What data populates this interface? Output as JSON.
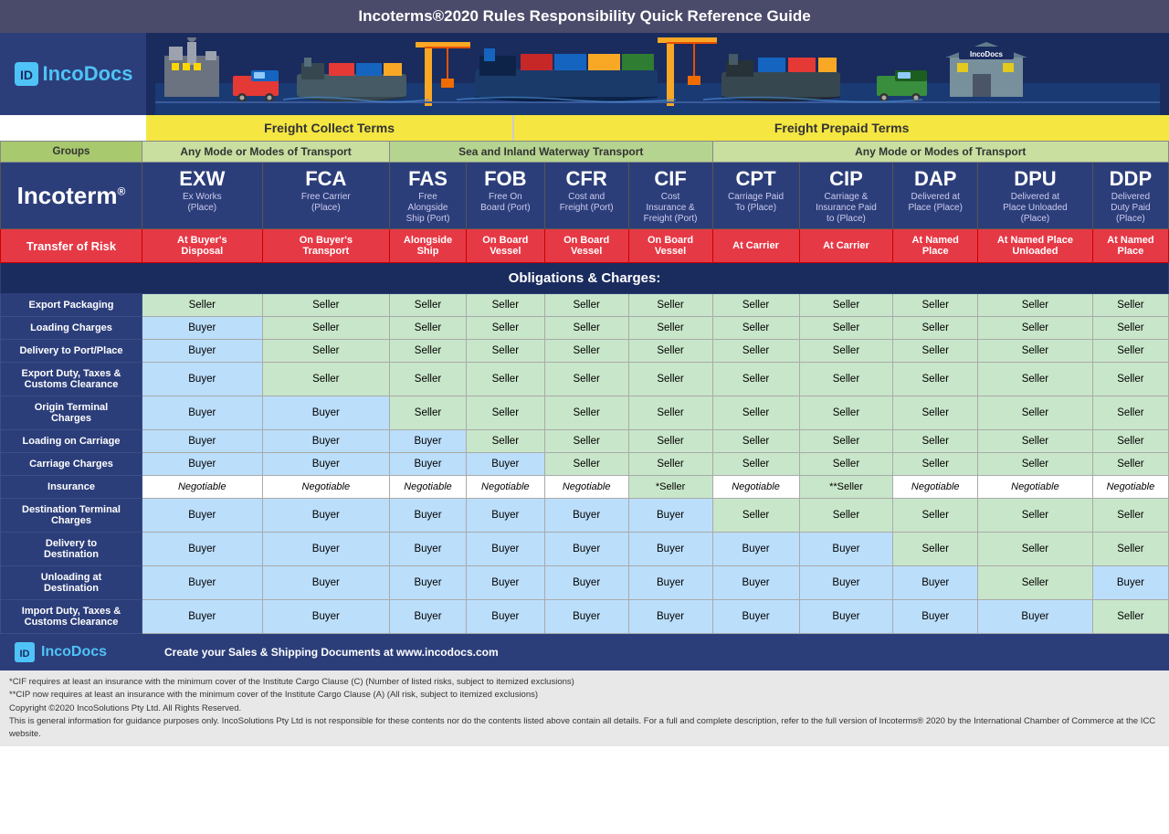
{
  "title": "Incoterms®2020 Rules Responsibility Quick Reference Guide",
  "logo": "IncoDocs",
  "logo_part1": "Inco",
  "logo_part2": "Docs",
  "freight_collect": "Freight Collect Terms",
  "freight_prepaid": "Freight Prepaid Terms",
  "groups_label": "Groups",
  "group_any1": "Any Mode or Modes of Transport",
  "group_sea": "Sea and Inland Waterway Transport",
  "group_any2": "Any Mode or Modes of Transport",
  "incoterm_label": "Incoterm",
  "incoterm_sup": "®",
  "transfer_risk_label": "Transfer of Risk",
  "obligations_header": "Obligations & Charges:",
  "incoterms": [
    {
      "code": "EXW",
      "desc": "Ex Works\n(Place)",
      "risk": "At Buyer's\nDisposal"
    },
    {
      "code": "FCA",
      "desc": "Free Carrier\n(Place)",
      "risk": "On Buyer's\nTransport"
    },
    {
      "code": "FAS",
      "desc": "Free\nAlongside\nShip (Port)",
      "risk": "Alongside\nShip"
    },
    {
      "code": "FOB",
      "desc": "Free On\nBoard (Port)",
      "risk": "On Board\nVessel"
    },
    {
      "code": "CFR",
      "desc": "Cost and\nFreight (Port)",
      "risk": "On Board\nVessel"
    },
    {
      "code": "CIF",
      "desc": "Cost\nInsurance &\nFreight (Port)",
      "risk": "On Board\nVessel"
    },
    {
      "code": "CPT",
      "desc": "Carriage Paid\nTo (Place)",
      "risk": "At Carrier"
    },
    {
      "code": "CIP",
      "desc": "Carriage &\nInsurance Paid\nto (Place)",
      "risk": "At Carrier"
    },
    {
      "code": "DAP",
      "desc": "Delivered at\nPlace (Place)",
      "risk": "At Named\nPlace"
    },
    {
      "code": "DPU",
      "desc": "Delivered at\nPlace Unloaded\n(Place)",
      "risk": "At Named Place\nUnloaded"
    },
    {
      "code": "DDP",
      "desc": "Delivered\nDuty Paid\n(Place)",
      "risk": "At Named\nPlace"
    }
  ],
  "obligations": [
    {
      "label": "Export Packaging",
      "cells": [
        "Seller",
        "Seller",
        "Seller",
        "Seller",
        "Seller",
        "Seller",
        "Seller",
        "Seller",
        "Seller",
        "Seller",
        "Seller"
      ]
    },
    {
      "label": "Loading Charges",
      "cells": [
        "Buyer",
        "Seller",
        "Seller",
        "Seller",
        "Seller",
        "Seller",
        "Seller",
        "Seller",
        "Seller",
        "Seller",
        "Seller"
      ]
    },
    {
      "label": "Delivery to Port/Place",
      "cells": [
        "Buyer",
        "Seller",
        "Seller",
        "Seller",
        "Seller",
        "Seller",
        "Seller",
        "Seller",
        "Seller",
        "Seller",
        "Seller"
      ]
    },
    {
      "label": "Export Duty, Taxes &\nCustoms Clearance",
      "cells": [
        "Buyer",
        "Seller",
        "Seller",
        "Seller",
        "Seller",
        "Seller",
        "Seller",
        "Seller",
        "Seller",
        "Seller",
        "Seller"
      ]
    },
    {
      "label": "Origin Terminal\nCharges",
      "cells": [
        "Buyer",
        "Buyer",
        "Seller",
        "Seller",
        "Seller",
        "Seller",
        "Seller",
        "Seller",
        "Seller",
        "Seller",
        "Seller"
      ]
    },
    {
      "label": "Loading on Carriage",
      "cells": [
        "Buyer",
        "Buyer",
        "Buyer",
        "Seller",
        "Seller",
        "Seller",
        "Seller",
        "Seller",
        "Seller",
        "Seller",
        "Seller"
      ]
    },
    {
      "label": "Carriage Charges",
      "cells": [
        "Buyer",
        "Buyer",
        "Buyer",
        "Buyer",
        "Seller",
        "Seller",
        "Seller",
        "Seller",
        "Seller",
        "Seller",
        "Seller"
      ]
    },
    {
      "label": "Insurance",
      "cells": [
        "Negotiable",
        "Negotiable",
        "Negotiable",
        "Negotiable",
        "Negotiable",
        "*Seller",
        "Negotiable",
        "**Seller",
        "Negotiable",
        "Negotiable",
        "Negotiable"
      ]
    },
    {
      "label": "Destination Terminal\nCharges",
      "cells": [
        "Buyer",
        "Buyer",
        "Buyer",
        "Buyer",
        "Buyer",
        "Buyer",
        "Seller",
        "Seller",
        "Seller",
        "Seller",
        "Seller"
      ]
    },
    {
      "label": "Delivery to\nDestination",
      "cells": [
        "Buyer",
        "Buyer",
        "Buyer",
        "Buyer",
        "Buyer",
        "Buyer",
        "Buyer",
        "Buyer",
        "Seller",
        "Seller",
        "Seller"
      ]
    },
    {
      "label": "Unloading at\nDestination",
      "cells": [
        "Buyer",
        "Buyer",
        "Buyer",
        "Buyer",
        "Buyer",
        "Buyer",
        "Buyer",
        "Buyer",
        "Buyer",
        "Seller",
        "Buyer"
      ]
    },
    {
      "label": "Import Duty, Taxes &\nCustoms Clearance",
      "cells": [
        "Buyer",
        "Buyer",
        "Buyer",
        "Buyer",
        "Buyer",
        "Buyer",
        "Buyer",
        "Buyer",
        "Buyer",
        "Buyer",
        "Seller"
      ]
    }
  ],
  "footer_tagline": "Create your Sales & Shipping Documents at www.incodocs.com",
  "footer_notes": [
    "*CIF requires at least an insurance with the minimum cover of the Institute Cargo Clause (C) (Number of listed risks, subject to itemized exclusions)",
    "**CIP now requires at least an insurance with the minimum cover of the Institute Cargo Clause (A) (All risk, subject to itemized exclusions)",
    "Copyright ©2020 IncoSolutions Pty Ltd. All Rights Reserved.",
    "This is general information for guidance purposes only. IncoSolutions Pty Ltd is not responsible for these contents nor do the contents listed above contain all details. For a full and complete description, refer to the full version of Incoterms® 2020 by the International Chamber of Commerce at the ICC website."
  ]
}
